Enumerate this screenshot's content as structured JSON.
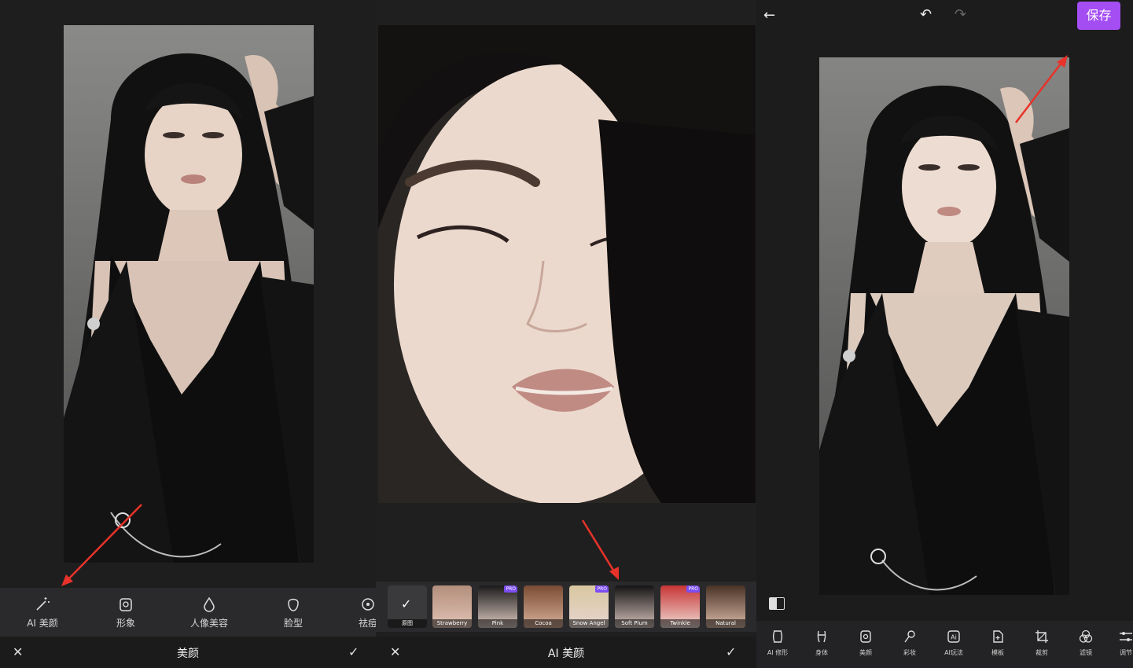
{
  "left_panel": {
    "tools": [
      {
        "icon": "magic-wand-icon",
        "label": "AI 美颜"
      },
      {
        "icon": "portrait-frame-icon",
        "label": "形象"
      },
      {
        "icon": "droplet-icon",
        "label": "人像美容"
      },
      {
        "icon": "face-outline-icon",
        "label": "脸型"
      },
      {
        "icon": "blemish-icon",
        "label": "祛痘"
      }
    ],
    "bottom_title": "美颜",
    "close_symbol": "✕",
    "confirm_symbol": "✓"
  },
  "middle_panel": {
    "styles": [
      {
        "label": "原图",
        "pro": false,
        "selected": true
      },
      {
        "label": "Strawberry",
        "pro": false,
        "selected": false
      },
      {
        "label": "Pink",
        "pro": true,
        "selected": false
      },
      {
        "label": "Cocoa",
        "pro": false,
        "selected": false
      },
      {
        "label": "Snow Angel",
        "pro": true,
        "selected": false
      },
      {
        "label": "Soft Plum",
        "pro": false,
        "selected": false
      },
      {
        "label": "Twinkle",
        "pro": true,
        "selected": false
      },
      {
        "label": "Natural",
        "pro": false,
        "selected": false
      }
    ],
    "pro_badge": "PRO",
    "selected_symbol": "✓",
    "bottom_title": "AI 美颜",
    "close_symbol": "✕",
    "confirm_symbol": "✓"
  },
  "right_panel": {
    "save_label": "保存",
    "back_symbol": "←",
    "undo_symbol": "↶",
    "redo_symbol": "↷",
    "tools": [
      {
        "icon": "auto-retouch-icon",
        "label": "AI 修形"
      },
      {
        "icon": "body-icon",
        "label": "身体"
      },
      {
        "icon": "beauty-icon",
        "label": "美颜"
      },
      {
        "icon": "makeup-brush-icon",
        "label": "彩妆"
      },
      {
        "icon": "ai-effects-icon",
        "label": "AI玩法"
      },
      {
        "icon": "template-icon",
        "label": "模板"
      },
      {
        "icon": "crop-icon",
        "label": "裁剪"
      },
      {
        "icon": "filter-icon",
        "label": "滤镜"
      },
      {
        "icon": "adjust-icon",
        "label": "调节"
      }
    ]
  },
  "colors": {
    "accent": "#a44df3",
    "arrow": "#e8322a",
    "pro_badge": "#7b4cf0"
  }
}
